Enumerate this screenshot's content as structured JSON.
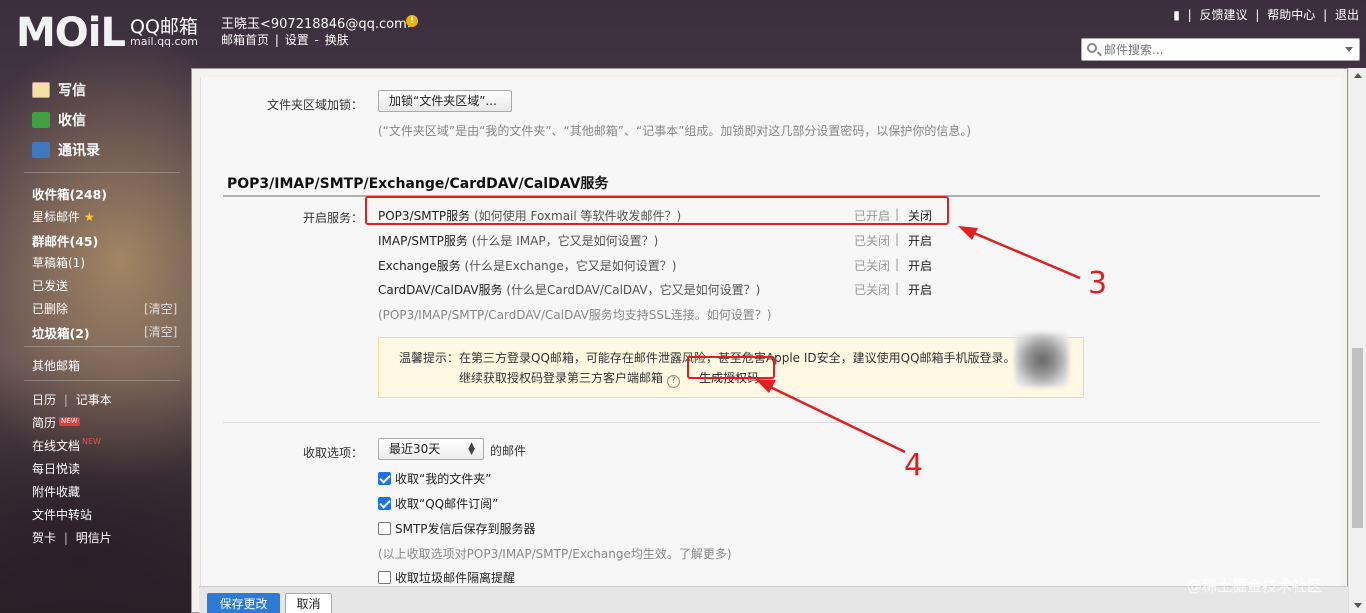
{
  "header": {
    "logo_text": "MOiL",
    "product_name": "QQ邮箱",
    "domain": "mail.qq.com",
    "user": "王晓玉<907218846@qq.com>",
    "nav": [
      "邮箱首页",
      "设置",
      "换肤"
    ],
    "nav_sep": "|",
    "nav_sep2": "-",
    "top_links": [
      "反馈建议",
      "帮助中心",
      "退出"
    ],
    "search_placeholder": "邮件搜索..."
  },
  "sidebar": {
    "actions": [
      "写信",
      "收信",
      "通讯录"
    ],
    "folders": [
      {
        "label": "收件箱(248)",
        "bold": true
      },
      {
        "label": "星标邮件",
        "bold": false
      },
      {
        "label": "群邮件(45)",
        "bold": true
      },
      {
        "label": "草稿箱(1)",
        "bold": false
      },
      {
        "label": "已发送",
        "bold": false
      },
      {
        "label": "已删除",
        "bold": false,
        "clear": "[清空]"
      },
      {
        "label": "垃圾箱(2)",
        "bold": true,
        "clear": "[清空]"
      }
    ],
    "other_mailbox": "其他邮箱",
    "apps": [
      {
        "label": "日历"
      },
      {
        "label": "记事本"
      },
      {
        "label": "简历",
        "badge": "NEW"
      },
      {
        "label": "在线文档",
        "badge": "NEW"
      },
      {
        "label": "每日悦读"
      },
      {
        "label": "附件收藏"
      },
      {
        "label": "文件中转站"
      },
      {
        "label": "贺卡"
      },
      {
        "label": "明信片"
      }
    ]
  },
  "folder_lock": {
    "label": "文件夹区域加锁：",
    "button": "加锁“文件夹区域”...",
    "hint": "(“文件夹区域”是由“我的文件夹”、“其他邮箱”、“记事本”组成。加锁即对这几部分设置密码，以保护你的信息。)"
  },
  "services": {
    "title": "POP3/IMAP/SMTP/Exchange/CardDAV/CalDAV服务",
    "label": "开启服务：",
    "items": [
      {
        "name": "POP3/SMTP服务",
        "paren": "(如何使用 Foxmail 等软件收发邮件？)",
        "status": "已开启",
        "action": "关闭"
      },
      {
        "name": "IMAP/SMTP服务",
        "paren": "(什么是 IMAP，它又是如何设置？)",
        "status": "已关闭",
        "action": "开启"
      },
      {
        "name": "Exchange服务",
        "paren": "(什么是Exchange，它又是如何设置？)",
        "status": "已关闭",
        "action": "开启"
      },
      {
        "name": "CardDAV/CalDAV服务",
        "paren": "(什么是CardDAV/CalDAV，它又是如何设置？)",
        "status": "已关闭",
        "action": "开启"
      }
    ],
    "status_sep": "|",
    "ssl_hint": "(POP3/IMAP/SMTP/CardDAV/CalDAV服务均支持SSL连接。如何设置？)",
    "tip_line1": "温馨提示：在第三方登录QQ邮箱，可能存在邮件泄露风险，甚至危害Apple ID安全，建议使用QQ邮箱手机版登录。",
    "tip_line2": "继续获取授权码登录第三方客户端邮箱",
    "help_glyph": "?",
    "gen_code": "生成授权码"
  },
  "receive": {
    "label": "收取选项：",
    "select_value": "最近30天",
    "select_suffix": "的邮件",
    "options": [
      {
        "label": "收取“我的文件夹”",
        "checked": true
      },
      {
        "label": "收取“QQ邮件订阅”",
        "checked": true
      },
      {
        "label": "SMTP发信后保存到服务器",
        "checked": false
      }
    ],
    "hint": "(以上收取选项对POP3/IMAP/SMTP/Exchange均生效。了解更多)",
    "spam_option": {
      "label": "收取垃圾邮件隔离提醒",
      "checked": false
    }
  },
  "footer": {
    "save": "保存更改",
    "cancel": "取消"
  },
  "annotations": {
    "num3": "3",
    "num4": "4"
  },
  "watermark": "@稀土掘金技术社区",
  "colors": {
    "annotation": "#e02020",
    "primary_button": "#2c7bd6",
    "checkbox_on": "#1a73e8"
  }
}
